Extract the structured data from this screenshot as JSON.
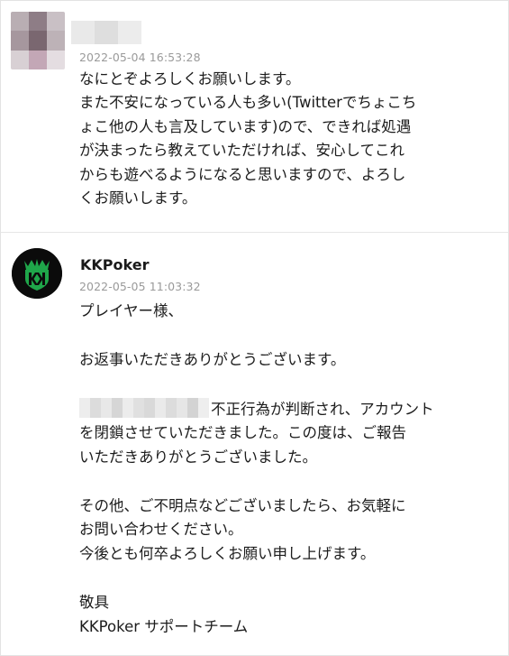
{
  "thread": {
    "message1": {
      "author_avatar": "pixelated-avatar",
      "author_name_hidden": true,
      "timestamp": "2022-05-04 16:53:28",
      "lines": [
        "なにとぞよろしくお願いします。",
        "また不安になっている人も多い(Twitterでちょこち",
        "ょこ他の人も言及しています)ので、できれば処遇",
        "が決まったら教えていただければ、安心してこれ",
        "からも遊べるようになると思いますので、よろし",
        "くお願いします。"
      ]
    },
    "message2": {
      "author_avatar": "kkpoker-logo",
      "author": "KKPoker",
      "timestamp": "2022-05-05 11:03:32",
      "greeting": "プレイヤー様、",
      "thanks": "お返事いただきありがとうございます。",
      "para2_line1_rest": "不正行為が判断され、アカウント",
      "para2_line2": "を閉鎖させていただきました。この度は、ご報告",
      "para2_line3": "いただきありがとうございました。",
      "para3_line1": "その他、ご不明点などございましたら、お気軽に",
      "para3_line2": "お問い合わせください。",
      "para3_line3": "今後とも何卒よろしくお願い申し上げます。",
      "closing": "敬具",
      "signature": "KKPoker サポートチーム"
    }
  },
  "colors": {
    "timestamp": "#9a9a9a",
    "text": "#1c1c1c",
    "logo_bg": "#0b0b0b",
    "logo_green": "#1fa64a"
  }
}
